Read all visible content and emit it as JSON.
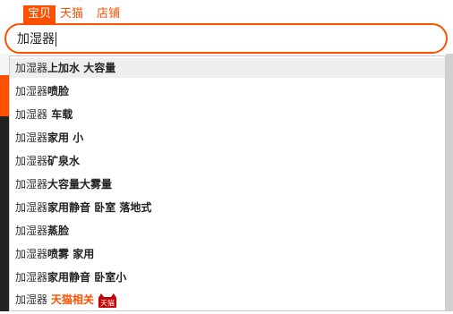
{
  "tabs": [
    {
      "label": "宝贝",
      "active": true
    },
    {
      "label": "天猫",
      "active": false
    },
    {
      "label": "店铺",
      "active": false
    }
  ],
  "search": {
    "value": "加湿器"
  },
  "suggestions": [
    {
      "query": "加湿器",
      "rest": "上加水 大容量"
    },
    {
      "query": "加湿器",
      "rest": "喷脸"
    },
    {
      "query": "加湿器",
      "rest": " 车载"
    },
    {
      "query": "加湿器",
      "rest": "家用 小"
    },
    {
      "query": "加湿器",
      "rest": "矿泉水"
    },
    {
      "query": "加湿器",
      "rest": "大容量大雾量"
    },
    {
      "query": "加湿器",
      "rest": "家用静音 卧室 落地式"
    },
    {
      "query": "加湿器",
      "rest": "蒸脸"
    },
    {
      "query": "加湿器",
      "rest": "喷雾 家用"
    },
    {
      "query": "加湿器",
      "rest": "家用静音 卧室小"
    }
  ],
  "tmall_suggestion": {
    "query": "加湿器",
    "tag": "天猫相关",
    "icon_label": "天猫"
  },
  "colors": {
    "accent": "#ff5000",
    "hover_bg": "#eeeeee"
  },
  "icons": {
    "tmall": "tmall-cat-icon"
  }
}
